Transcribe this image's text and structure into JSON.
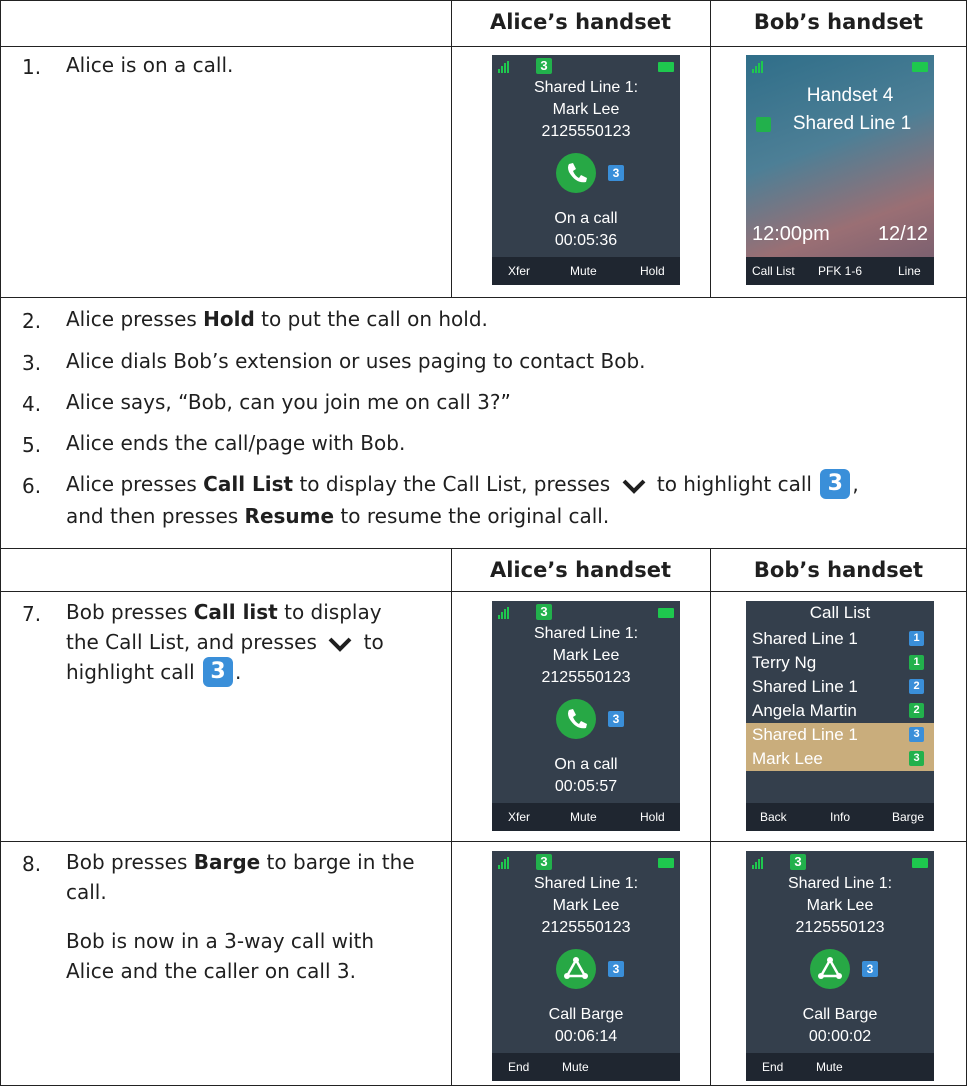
{
  "headers": {
    "alice": "Alice’s handset",
    "bob": "Bob’s handset"
  },
  "steps": [
    {
      "num": "1.",
      "text": "Alice is on a call."
    },
    {
      "num": "2.",
      "pre": "Alice presses ",
      "bold": "Hold",
      "post": " to put the call on hold."
    },
    {
      "num": "3.",
      "text": "Alice dials Bob’s extension or uses paging to contact Bob."
    },
    {
      "num": "4.",
      "text": "Alice says, “Bob, can you join me on call 3?”"
    },
    {
      "num": "5.",
      "text": "Alice ends the call/page with Bob."
    },
    {
      "num": "6.",
      "a": "Alice presses ",
      "b": "Call List",
      "c": " to display the Call List, presses ",
      "d": " to highlight call ",
      "e": ",",
      "f": "and then presses ",
      "g": "Resume",
      "h": " to resume the original call."
    },
    {
      "num": "7.",
      "a": "Bob presses ",
      "b": "Call list",
      "c": " to display",
      "d": "the Call List, and presses ",
      "e": " to",
      "f": "highlight call ",
      "g": "."
    },
    {
      "num": "8.",
      "a": "Bob presses ",
      "b": "Barge",
      "c": " to barge in the",
      "d": "call.",
      "e": "Bob is now in a 3-way call with",
      "f": "Alice and the caller on call 3."
    }
  ],
  "call_badge": "3",
  "phones": {
    "p1_alice": {
      "line": "3",
      "l1": "Shared Line 1:",
      "l2": "Mark Lee",
      "l3": "2125550123",
      "status": "On a call",
      "time": "00:05:36",
      "sk": [
        "Xfer",
        "Mute",
        "Hold"
      ]
    },
    "p1_bob": {
      "title": "Handset 4",
      "line": "Shared Line 1",
      "time": "12:00pm",
      "date": "12/12",
      "sk": [
        "Call List",
        "PFK 1-6",
        "Line"
      ]
    },
    "p7_alice": {
      "line": "3",
      "l1": "Shared Line 1:",
      "l2": "Mark Lee",
      "l3": "2125550123",
      "status": "On a call",
      "time": "00:05:57",
      "sk": [
        "Xfer",
        "Mute",
        "Hold"
      ]
    },
    "p7_bob": {
      "title": "Call List",
      "rows": [
        {
          "name": "Shared Line 1",
          "badge": "1",
          "color": "#3a8fd9"
        },
        {
          "name": "Terry Ng",
          "badge": "1",
          "color": "#22b14c"
        },
        {
          "name": "Shared Line 1",
          "badge": "2",
          "color": "#3a8fd9"
        },
        {
          "name": "Angela Martin",
          "badge": "2",
          "color": "#22b14c"
        },
        {
          "name": "Shared Line 1",
          "badge": "3",
          "color": "#3a8fd9"
        },
        {
          "name": "Mark Lee",
          "badge": "3",
          "color": "#22b14c"
        }
      ],
      "sk": [
        "Back",
        "Info",
        "Barge"
      ]
    },
    "p8_alice": {
      "line": "3",
      "l1": "Shared Line 1:",
      "l2": "Mark Lee",
      "l3": "2125550123",
      "status": "Call Barge",
      "time": "00:06:14",
      "sk": [
        "End",
        "Mute"
      ]
    },
    "p8_bob": {
      "line": "3",
      "l1": "Shared Line 1:",
      "l2": "Mark Lee",
      "l3": "2125550123",
      "status": "Call Barge",
      "time": "00:00:02",
      "sk": [
        "End",
        "Mute"
      ]
    }
  }
}
